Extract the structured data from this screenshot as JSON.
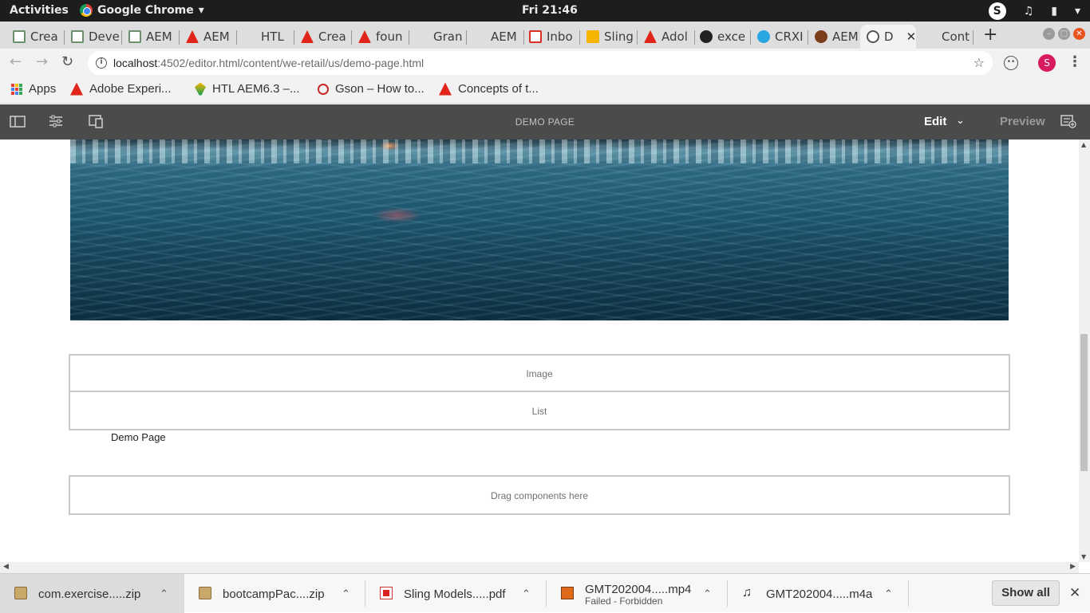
{
  "os": {
    "activities": "Activities",
    "app_name": "Google Chrome",
    "app_caret": "▾",
    "clock": "Fri 21:46",
    "tray_badge": "S",
    "tray_icons": [
      "volume-icon",
      "battery-icon",
      "power-caret-icon"
    ]
  },
  "tabs": [
    {
      "label": "Crea",
      "favicon": "generic"
    },
    {
      "label": "Deve",
      "favicon": "generic"
    },
    {
      "label": "AEM",
      "favicon": "generic"
    },
    {
      "label": "AEM",
      "favicon": "adobe"
    },
    {
      "label": "HTL",
      "favicon": "blank"
    },
    {
      "label": "Crea",
      "favicon": "adobe"
    },
    {
      "label": "foun",
      "favicon": "adobe"
    },
    {
      "label": "Gran",
      "favicon": "blank"
    },
    {
      "label": "AEM",
      "favicon": "blank"
    },
    {
      "label": "Inbo",
      "favicon": "gmail"
    },
    {
      "label": "Sling",
      "favicon": "slides"
    },
    {
      "label": "Adol",
      "favicon": "adobe"
    },
    {
      "label": "exce",
      "favicon": "github"
    },
    {
      "label": "CRXI",
      "favicon": "crx"
    },
    {
      "label": "AEM",
      "favicon": "aem"
    },
    {
      "label": "D",
      "favicon": "globe",
      "active": true
    },
    {
      "label": "Cont",
      "favicon": "blank"
    }
  ],
  "tab_close": "✕",
  "new_tab": "+",
  "address": {
    "host": "localhost",
    "path": ":4502/editor.html/content/we-retail/us/demo-page.html"
  },
  "profile_initial": "S",
  "bookmarks": [
    {
      "label": "Apps"
    },
    {
      "label": "Adobe Experi..."
    },
    {
      "label": "HTL AEM6.3 –..."
    },
    {
      "label": "Gson – How to..."
    },
    {
      "label": "Concepts of t..."
    }
  ],
  "editor": {
    "page_title": "DEMO PAGE",
    "mode_label": "Edit",
    "preview_label": "Preview"
  },
  "page": {
    "components": [
      {
        "placeholder": "Image"
      },
      {
        "placeholder": "List"
      }
    ],
    "text": "Demo Page",
    "drop_hint": "Drag components here"
  },
  "downloads": [
    {
      "name": "com.exercise.....zip",
      "type": "zip"
    },
    {
      "name": "bootcampPac....zip",
      "type": "zip"
    },
    {
      "name": "Sling Models.....pdf",
      "type": "pdf"
    },
    {
      "name": "GMT202004.....mp4",
      "status": "Failed - Forbidden",
      "type": "mp4"
    },
    {
      "name": "GMT202004.....m4a",
      "type": "m4a"
    }
  ],
  "show_all": "Show all"
}
